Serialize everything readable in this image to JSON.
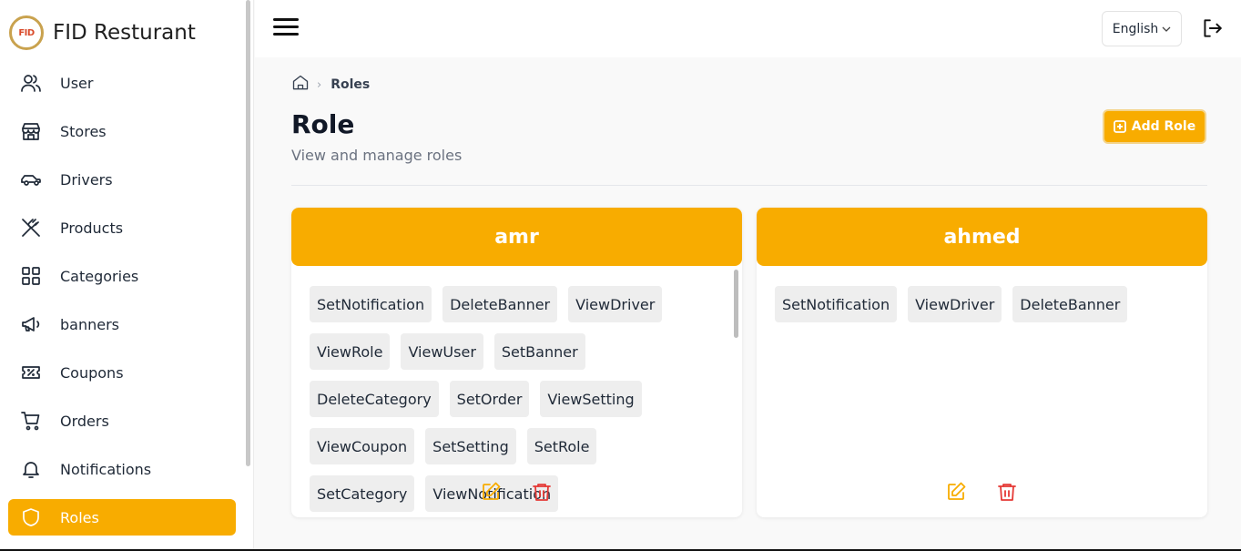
{
  "app": {
    "title": "FID Resturant",
    "logo_text": "FID"
  },
  "sidebar": {
    "items": [
      {
        "label": "User",
        "icon": "users-icon",
        "active": false
      },
      {
        "label": "Stores",
        "icon": "store-icon",
        "active": false
      },
      {
        "label": "Drivers",
        "icon": "car-icon",
        "active": false
      },
      {
        "label": "Products",
        "icon": "utensils-icon",
        "active": false
      },
      {
        "label": "Categories",
        "icon": "grid-icon",
        "active": false
      },
      {
        "label": "banners",
        "icon": "megaphone-icon",
        "active": false
      },
      {
        "label": "Coupons",
        "icon": "ticket-icon",
        "active": false
      },
      {
        "label": "Orders",
        "icon": "cart-icon",
        "active": false
      },
      {
        "label": "Notifications",
        "icon": "bell-icon",
        "active": false
      },
      {
        "label": "Roles",
        "icon": "shield-icon",
        "active": true
      }
    ]
  },
  "topbar": {
    "language": "English"
  },
  "breadcrumb": {
    "current": "Roles"
  },
  "page": {
    "title": "Role",
    "subtitle": "View and manage roles",
    "add_button": "Add Role"
  },
  "roles": [
    {
      "name": "amr",
      "permissions": [
        "SetNotification",
        "DeleteBanner",
        "ViewDriver",
        "ViewRole",
        "ViewUser",
        "SetBanner",
        "DeleteCategory",
        "SetOrder",
        "ViewSetting",
        "ViewCoupon",
        "SetSetting",
        "SetRole",
        "SetCategory",
        "ViewNotification"
      ]
    },
    {
      "name": "ahmed",
      "permissions": [
        "SetNotification",
        "ViewDriver",
        "DeleteBanner"
      ]
    }
  ],
  "colors": {
    "accent": "#f8ac00",
    "danger": "#e53935"
  }
}
